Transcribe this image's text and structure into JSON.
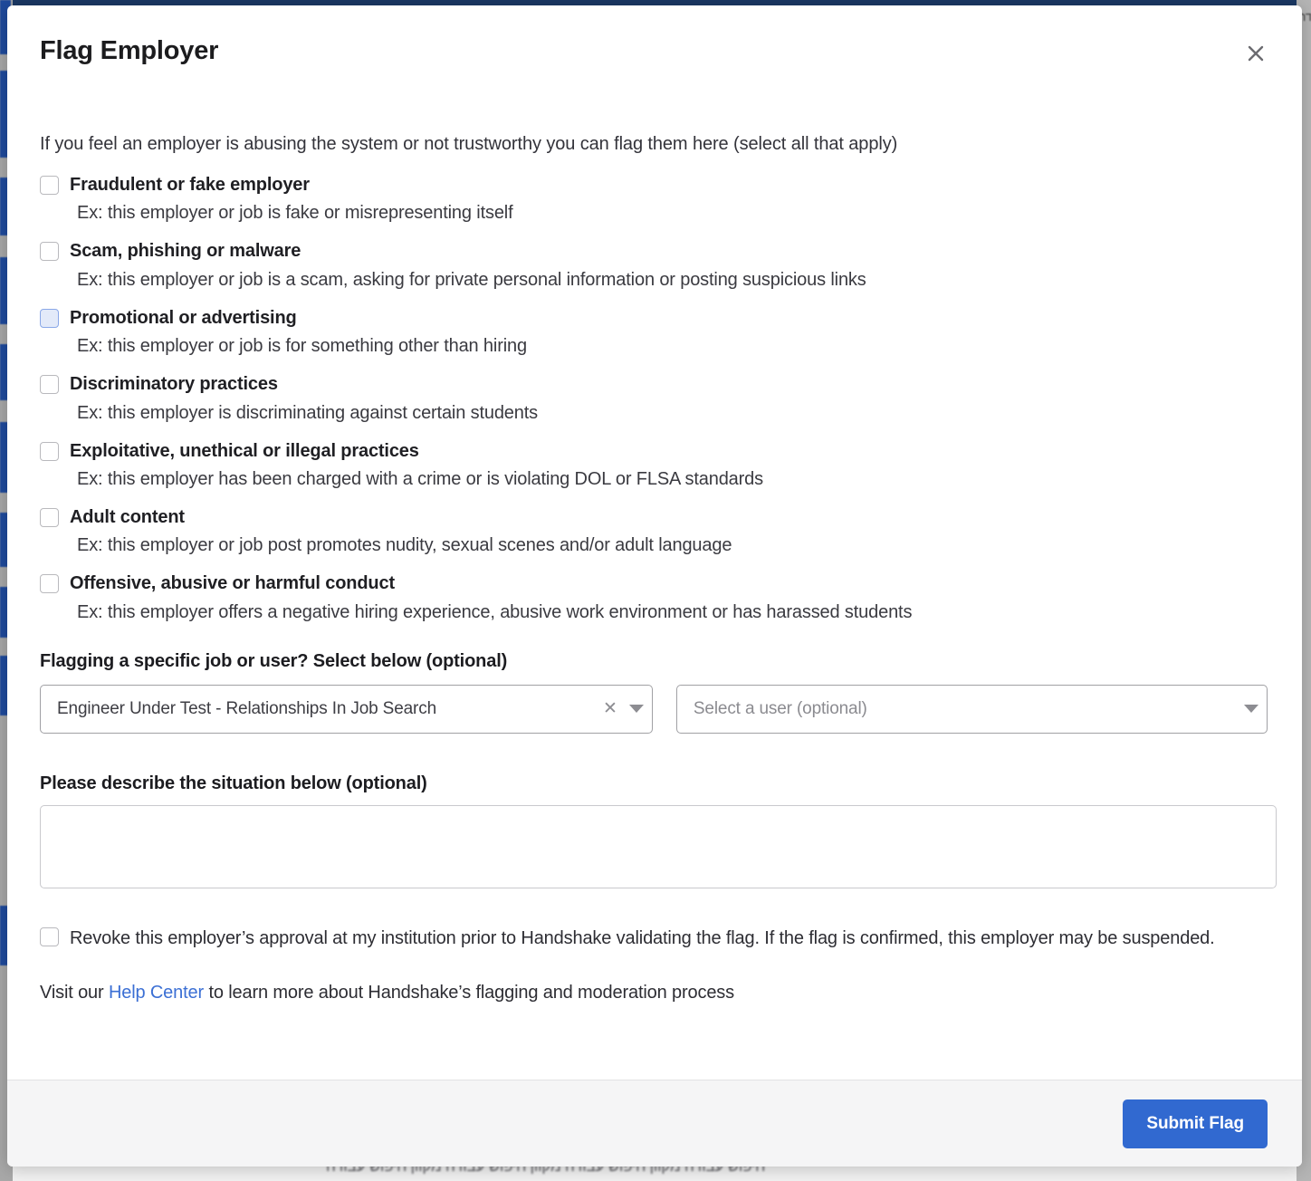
{
  "modal": {
    "title": "Flag Employer",
    "close_label": "✕",
    "intro": "If you feel an employer is abusing the system or not trustworthy you can flag them here (select all that apply)",
    "reasons": [
      {
        "label": "Fraudulent or fake employer",
        "example": "Ex: this employer or job is fake or misrepresenting itself",
        "checked": false,
        "focused": false
      },
      {
        "label": "Scam, phishing or malware",
        "example": "Ex: this employer or job is a scam, asking for private personal information or posting suspicious links",
        "checked": false,
        "focused": false
      },
      {
        "label": "Promotional or advertising",
        "example": "Ex: this employer or job is for something other than hiring",
        "checked": false,
        "focused": true
      },
      {
        "label": "Discriminatory practices",
        "example": "Ex: this employer is discriminating against certain students",
        "checked": false,
        "focused": false
      },
      {
        "label": "Exploitative, unethical or illegal practices",
        "example": "Ex: this employer has been charged with a crime or is violating DOL or FLSA standards",
        "checked": false,
        "focused": false
      },
      {
        "label": "Adult content",
        "example": "Ex: this employer or job post promotes nudity, sexual scenes and/or adult language",
        "checked": false,
        "focused": false
      },
      {
        "label": "Offensive, abusive or harmful conduct",
        "example": "Ex: this employer offers a negative hiring experience, abusive work environment or has harassed students",
        "checked": false,
        "focused": false
      }
    ],
    "select_section": {
      "heading": "Flagging a specific job or user? Select below (optional)",
      "job_select": {
        "value": "Engineer Under Test - Relationships In Job Search",
        "clear_label": "✕",
        "has_clear": true
      },
      "user_select": {
        "placeholder": "Select a user (optional)",
        "value": ""
      }
    },
    "describe_section": {
      "heading": "Please describe the situation below (optional)",
      "value": "",
      "placeholder": ""
    },
    "revoke": {
      "text": "Revoke this employer’s approval at my institution prior to Handshake validating the flag. If the flag is confirmed, this employer may be suspended.",
      "checked": false
    },
    "help": {
      "prefix": "Visit our ",
      "link_text": "Help Center",
      "suffix": " to learn more about Handshake’s flagging and moderation process"
    },
    "footer": {
      "submit_label": "Submit Flag"
    }
  },
  "colors": {
    "accent": "#3169d0",
    "link": "#3b6fd4",
    "focus_checkbox_bg": "#e3eaf9",
    "focus_checkbox_border": "#8aa8e8",
    "footer_bg": "#f5f5f6",
    "backdrop_navy": "#1f4a9c"
  },
  "backdrop": {
    "bottom_text": "חיפוש עבודה מקוון חיפוש עבודה מקוון חיפוש עבודה מקוון חיפוש עבודה",
    "side_text": "עבודה"
  }
}
